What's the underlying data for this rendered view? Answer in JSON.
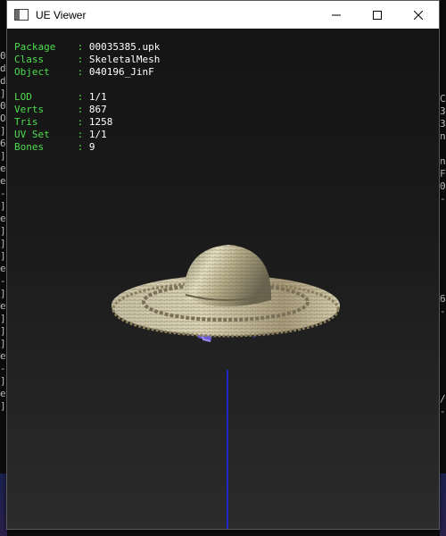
{
  "window": {
    "title": "UE Viewer"
  },
  "info": {
    "package_label": "Package",
    "package_value": "00035385.upk",
    "class_label": "Class",
    "class_value": "SkeletalMesh",
    "object_label": "Object",
    "object_value": "040196_JinF",
    "lod_label": "LOD",
    "lod_value": "1/1",
    "verts_label": "Verts",
    "verts_value": "867",
    "tris_label": "Tris",
    "tris_value": "1258",
    "uvset_label": "UV Set",
    "uvset_value": "1/1",
    "bones_label": "Bones",
    "bones_value": "9",
    "separator": " : "
  },
  "background_console": {
    "left_chars": "0\nd\nd\n]\n0\nO\n]\n6\n]\ne\ne\n-\n]\ne\n]\n]\n]\ne\n-\n]\ne\n]\n]\n]\ne\n-\n]\ne\n]",
    "right_chars": "C\n3\n3\nn\n\nn\nF\n0\n-\n\n\n\n\n\n\n\n6\n-\n\n\n\n\n\n\n/\n-"
  },
  "colors": {
    "label_green": "#4ddc4d",
    "value_white": "#ffffff",
    "axis_blue": "#2228c8"
  },
  "icons": {
    "app": "window-app-icon",
    "minimize": "minimize-icon",
    "maximize": "maximize-icon",
    "close": "close-icon"
  }
}
